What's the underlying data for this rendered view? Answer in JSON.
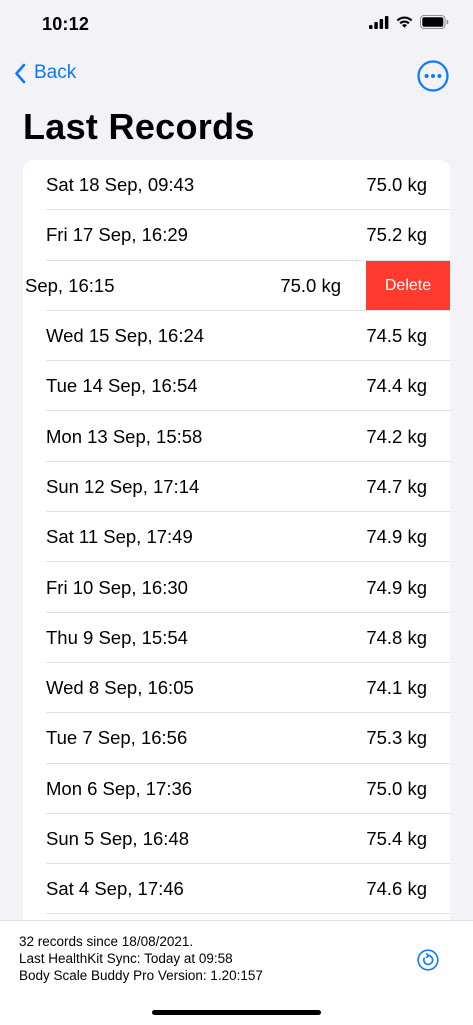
{
  "status_bar": {
    "time": "10:12",
    "icons": [
      "cellular-signal-icon",
      "wifi-icon",
      "battery-icon"
    ]
  },
  "nav": {
    "back_label": "Back",
    "more_icon": "ellipsis-circle-icon"
  },
  "page": {
    "title": "Last Records"
  },
  "records": [
    {
      "date": "Sat 18 Sep, 09:43",
      "weight": "75.0 kg"
    },
    {
      "date": "Fri 17 Sep, 16:29",
      "weight": "75.2 kg"
    },
    {
      "date": "Sep, 16:15",
      "weight": "75.0 kg",
      "action": "Delete"
    },
    {
      "date": "Wed 15 Sep, 16:24",
      "weight": "74.5 kg"
    },
    {
      "date": "Tue 14 Sep, 16:54",
      "weight": "74.4 kg"
    },
    {
      "date": "Mon 13 Sep, 15:58",
      "weight": "74.2 kg"
    },
    {
      "date": "Sun 12 Sep, 17:14",
      "weight": "74.7 kg"
    },
    {
      "date": "Sat 11 Sep, 17:49",
      "weight": "74.9 kg"
    },
    {
      "date": "Fri 10 Sep, 16:30",
      "weight": "74.9 kg"
    },
    {
      "date": "Thu 9 Sep, 15:54",
      "weight": "74.8 kg"
    },
    {
      "date": "Wed 8 Sep, 16:05",
      "weight": "74.1 kg"
    },
    {
      "date": "Tue 7 Sep, 16:56",
      "weight": "75.3 kg"
    },
    {
      "date": "Mon 6 Sep, 17:36",
      "weight": "75.0 kg"
    },
    {
      "date": "Sun 5 Sep, 16:48",
      "weight": "75.4 kg"
    },
    {
      "date": "Sat 4 Sep, 17:46",
      "weight": "74.6 kg"
    }
  ],
  "footer": {
    "records_summary": "32 records since 18/08/2021.",
    "last_sync": "Last HealthKit Sync: Today at 09:58",
    "version": "Body Scale Buddy Pro Version: 1.20:157",
    "sync_icon": "sync-circle-icon"
  },
  "colors": {
    "accent": "#0a7aff",
    "delete": "#ff3b30",
    "background": "#f2f2f7"
  }
}
